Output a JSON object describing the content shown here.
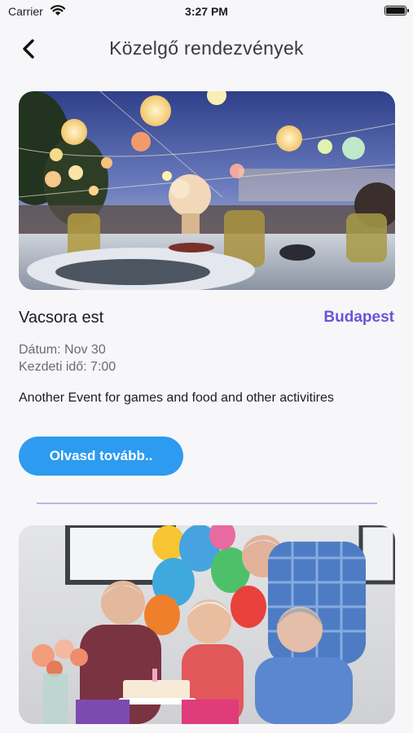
{
  "status": {
    "carrier": "Carrier",
    "time": "3:27 PM"
  },
  "nav": {
    "title": "Közelgő rendezvények",
    "back_icon": "chevron-left-icon"
  },
  "events": [
    {
      "image": "dinner-party-photo",
      "title": "Vacsora est",
      "city": "Budapest",
      "date": "Dátum: Nov 30",
      "start_time": "Kezdeti idő: 7:00",
      "description": "Another Event for games and food and other activitires",
      "button": "Olvasd tovább.."
    },
    {
      "image": "birthday-party-photo"
    }
  ],
  "colors": {
    "accent_text": "#6e52d6",
    "button_bg": "#2d9bf0",
    "divider": "#b9b6e8",
    "background": "#f7f7f9"
  }
}
